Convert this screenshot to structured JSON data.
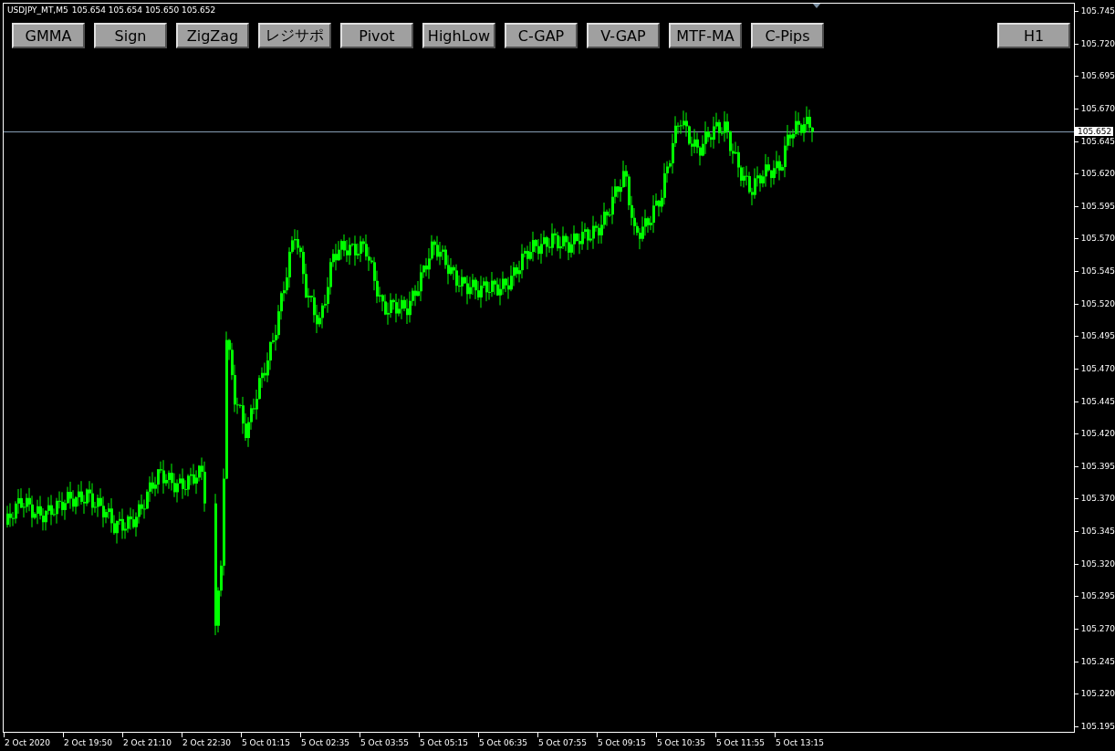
{
  "window": {
    "title": "USDJPY_MT,M5"
  },
  "quote": [
    "105.654",
    "105.654",
    "105.650",
    "105.652"
  ],
  "buttons": [
    {
      "label": "GMMA",
      "kind": "indicator"
    },
    {
      "label": "Sign",
      "kind": "indicator"
    },
    {
      "label": "ZigZag",
      "kind": "indicator"
    },
    {
      "label": "レジサポ",
      "kind": "indicator"
    },
    {
      "label": "Pivot",
      "kind": "indicator"
    },
    {
      "label": "HighLow",
      "kind": "indicator"
    },
    {
      "label": "C-GAP",
      "kind": "indicator"
    },
    {
      "label": "V-GAP",
      "kind": "indicator"
    },
    {
      "label": "MTF-MA",
      "kind": "indicator"
    },
    {
      "label": "C-Pips",
      "kind": "indicator"
    },
    {
      "label": "H1",
      "kind": "timeframe"
    }
  ],
  "current_price": "105.652",
  "price_ticks": [
    "105.745",
    "105.720",
    "105.695",
    "105.670",
    "105.645",
    "105.620",
    "105.595",
    "105.570",
    "105.545",
    "105.520",
    "105.495",
    "105.470",
    "105.445",
    "105.420",
    "105.395",
    "105.370",
    "105.345",
    "105.320",
    "105.295",
    "105.270",
    "105.245",
    "105.220",
    "105.195"
  ],
  "time_ticks": [
    "2 Oct 2020",
    "2 Oct 19:50",
    "2 Oct 21:10",
    "2 Oct 22:30",
    "5 Oct 01:15",
    "5 Oct 02:35",
    "5 Oct 03:55",
    "5 Oct 05:15",
    "5 Oct 06:35",
    "5 Oct 07:55",
    "5 Oct 09:15",
    "5 Oct 10:35",
    "5 Oct 11:55",
    "5 Oct 13:15"
  ]
}
